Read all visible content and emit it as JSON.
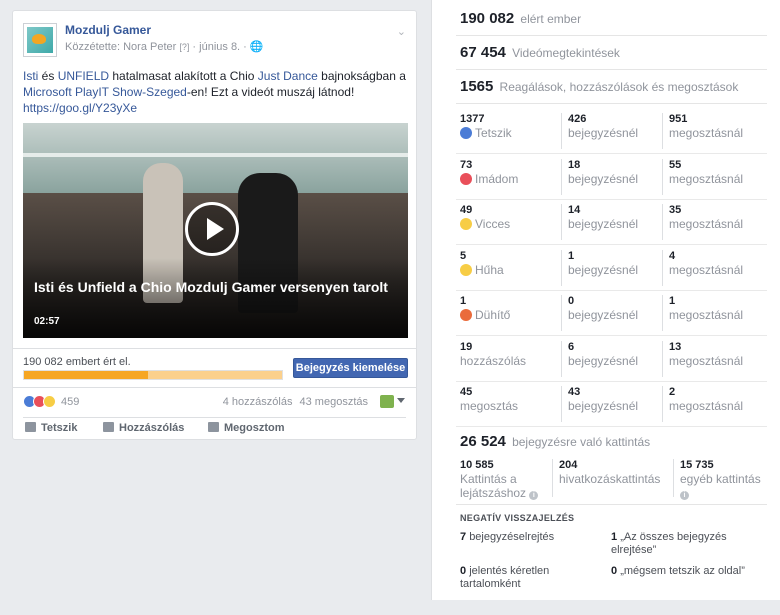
{
  "post": {
    "page_name": "Mozdulj Gamer",
    "published_by": "Közzétette: Nora Peter",
    "published_q": "[?]",
    "date": "· június 8. ·",
    "globe": "🌐",
    "chevron": "⌄",
    "text_parts": {
      "p1": "Isti",
      "p2": " és ",
      "p3": "UNFIELD",
      "p4": " hatalmasat alakított a Chio ",
      "p5": "Just Dance",
      "p6": " bajnokságban a ",
      "p7": "Microsoft PlayIT Show-Szeged",
      "p8": "-en! Ezt a videót muszáj látnod!",
      "p9": "https://goo.gl/Y23yXe"
    },
    "video_title": "Isti és Unfield a Chio Mozdulj Gamer versenyen tarolt",
    "video_duration": "02:57",
    "reach_text": "190 082 embert ért el.",
    "reach_fraction": 0.48,
    "boost_label": "Bejegyzés kiemelése",
    "reaction_count": "459",
    "comments": "4 hozzászólás",
    "shares": "43 megosztás",
    "action_like": "Tetszik",
    "action_comment": "Hozzászólás",
    "action_share": "Megosztom"
  },
  "insights": {
    "reach_value": "190 082",
    "reach_label": "elért ember",
    "views_value": "67 454",
    "views_label": "Videómegtekintések",
    "engage_value": "1565",
    "engage_label": "Reagálások, hozzászólások és megosztások",
    "rows": [
      {
        "total": "1377",
        "label": "Tetszik",
        "icon": "like",
        "post_v": "426",
        "post_l": "bejegyzésnél",
        "share_v": "951",
        "share_l": "megosztásnál"
      },
      {
        "total": "73",
        "label": "Imádom",
        "icon": "love",
        "post_v": "18",
        "post_l": "bejegyzésnél",
        "share_v": "55",
        "share_l": "megosztásnál"
      },
      {
        "total": "49",
        "label": "Vicces",
        "icon": "haha",
        "post_v": "14",
        "post_l": "bejegyzésnél",
        "share_v": "35",
        "share_l": "megosztásnál"
      },
      {
        "total": "5",
        "label": "Hűha",
        "icon": "wow",
        "post_v": "1",
        "post_l": "bejegyzésnél",
        "share_v": "4",
        "share_l": "megosztásnál"
      },
      {
        "total": "1",
        "label": "Dühítő",
        "icon": "angry",
        "post_v": "0",
        "post_l": "bejegyzésnél",
        "share_v": "1",
        "share_l": "megosztásnál"
      },
      {
        "total": "19",
        "label": "hozzászólás",
        "icon": "",
        "post_v": "6",
        "post_l": "bejegyzésnél",
        "share_v": "13",
        "share_l": "megosztásnál"
      },
      {
        "total": "45",
        "label": "megosztás",
        "icon": "",
        "post_v": "43",
        "post_l": "bejegyzésnél",
        "share_v": "2",
        "share_l": "megosztásnál"
      }
    ],
    "clicks_value": "26 524",
    "clicks_label": "bejegyzésre való kattintás",
    "clicks": {
      "play_v": "10 585",
      "play_l": "Kattintás a lejátszáshoz",
      "link_v": "204",
      "link_l": "hivatkozáskattintás",
      "other_v": "15 735",
      "other_l": "egyéb kattintás"
    },
    "info_glyph": "i",
    "negative": {
      "title": "NEGATÍV VISSZAJELZÉS",
      "hide_v": "7",
      "hide_l": "bejegyzéselrejtés",
      "hide_all_v": "1",
      "hide_all_l": "„Az összes bejegyzés elrejtése”",
      "spam_v": "0",
      "spam_l": "jelentés kéretlen tartalomként",
      "unlike_v": "0",
      "unlike_l": "„mégsem tetszik az oldal”"
    }
  },
  "colors": {
    "accent": "#4267b2",
    "link": "#365899",
    "reach_bar": "#f6a623"
  }
}
